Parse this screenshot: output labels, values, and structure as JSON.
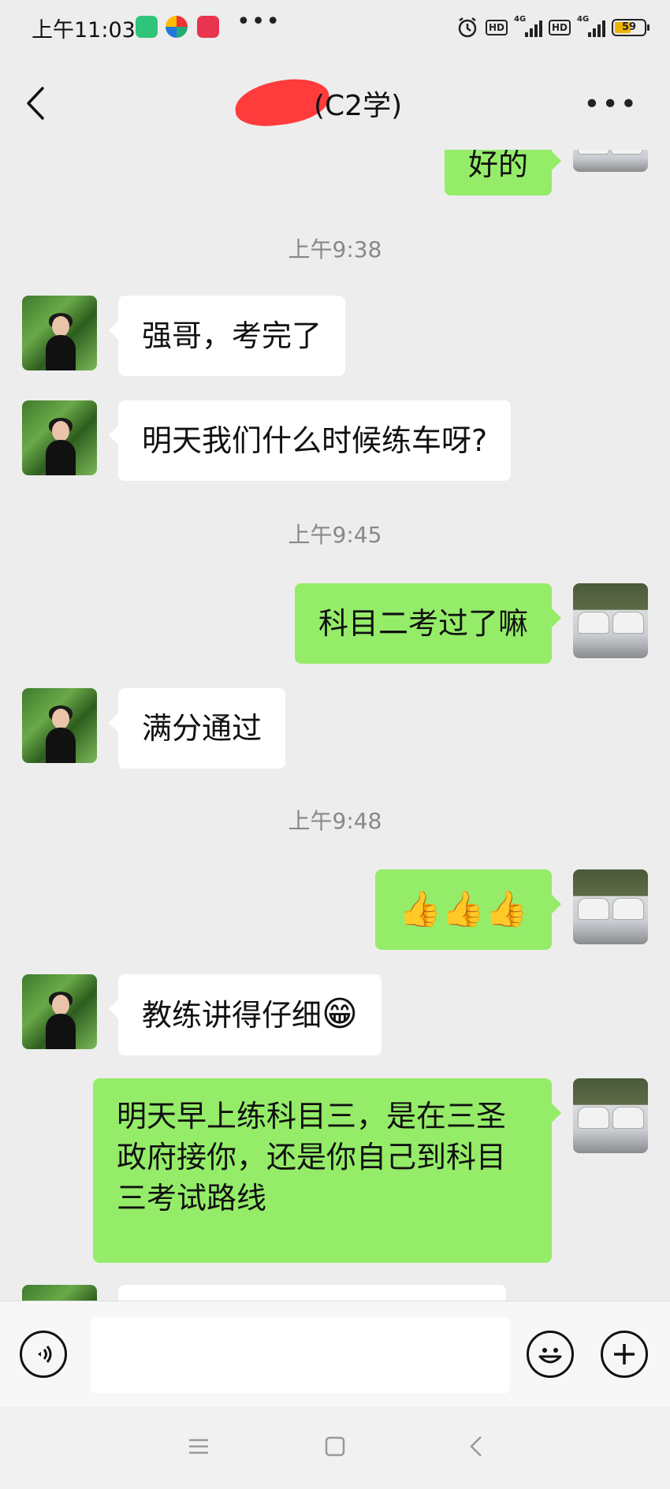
{
  "status_bar": {
    "time": "上午11:03",
    "dots": "•••",
    "network_1": "4G",
    "network_2": "4G",
    "hd_1": "HD",
    "hd_2": "HD",
    "battery": "59"
  },
  "header": {
    "title": "(C2学)"
  },
  "messages": [
    {
      "type": "out",
      "text": "好的"
    },
    {
      "type": "time",
      "text": "上午9:38"
    },
    {
      "type": "in",
      "text": "强哥，考完了"
    },
    {
      "type": "in",
      "text": "明天我们什么时候练车呀?"
    },
    {
      "type": "time",
      "text": "上午9:45"
    },
    {
      "type": "out",
      "text": "科目二考过了嘛"
    },
    {
      "type": "in",
      "text": "满分通过"
    },
    {
      "type": "time",
      "text": "上午9:48"
    },
    {
      "type": "out",
      "text": "👍👍👍"
    },
    {
      "type": "in",
      "text": "教练讲得仔细",
      "emoji": "😁"
    },
    {
      "type": "out",
      "text": "明天早上练科目三，是在三圣政府接你，还是你自己到科目三考试路线"
    }
  ],
  "colors": {
    "outgoing_bubble": "#95ec69",
    "incoming_bubble": "#ffffff",
    "background": "#ededed"
  }
}
